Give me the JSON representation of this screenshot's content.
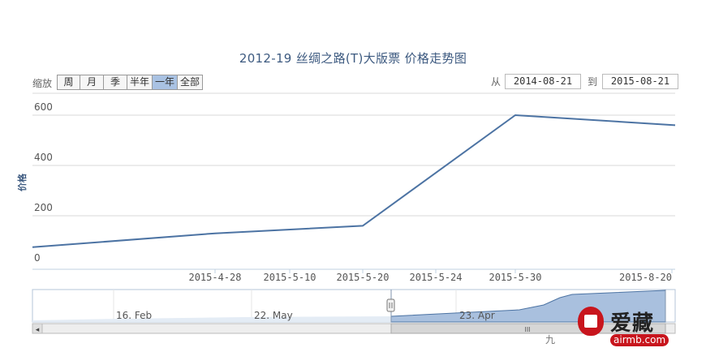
{
  "chart_data": {
    "type": "line",
    "title": "2012-19 丝绸之路(T)大版票 价格走势图",
    "ylabel": "价格",
    "ylim": [
      0,
      700
    ],
    "yticks": [
      0,
      200,
      400,
      600
    ],
    "x_tick_labels": [
      "2015-4-28",
      "2015-5-10",
      "2015-5-20",
      "2015-5-24",
      "2015-5-30",
      "2015-8-20"
    ],
    "series": [
      {
        "name": "",
        "x": [
          "2014-08-21",
          "2015-4-28",
          "2015-5-20",
          "2015-5-30",
          "2015-8-21"
        ],
        "values": [
          75,
          130,
          160,
          600,
          560
        ]
      }
    ],
    "grid": true,
    "color": "#4c73a3"
  },
  "toolbar": {
    "zoom_label": "缩放",
    "zoom_buttons": [
      "周",
      "月",
      "季",
      "半年",
      "一年",
      "全部"
    ],
    "active_zoom": "一年",
    "from_label": "从",
    "from_value": "2014-08-21",
    "to_label": "到",
    "to_value": "2015-08-21"
  },
  "navigator": {
    "labels": [
      "16. Feb",
      "22. May",
      "23. Apr"
    ],
    "scroll_grip": "III",
    "left_arrow": "◂"
  },
  "watermark": {
    "brand": "爱藏",
    "url": "airmb.com",
    "partial_text": "九"
  }
}
